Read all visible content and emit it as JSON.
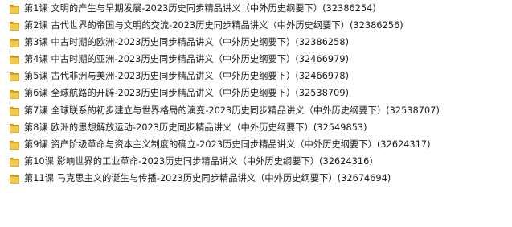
{
  "folders": [
    {
      "label": "第1课  文明的产生与早期发展-2023历史同步精品讲义（中外历史纲要下）(32386254)"
    },
    {
      "label": "第2课  古代世界的帝国与文明的交流-2023历史同步精品讲义（中外历史纲要下）(32386256)"
    },
    {
      "label": "第3课  中古时期的欧洲-2023历史同步精品讲义（中外历史纲要下）(32386258)"
    },
    {
      "label": "第4课  中古时期的亚洲-2023历史同步精品讲义（中外历史纲要下）(32466979)"
    },
    {
      "label": "第5课  古代非洲与美洲-2023历史同步精品讲义（中外历史纲要下）(32466978)"
    },
    {
      "label": "第6课  全球航路的开辟-2023历史同步精品讲义（中外历史纲要下）(32538709)"
    },
    {
      "label": "第7课  全球联系的初步建立与世界格局的演变-2023历史同步精品讲义（中外历史纲要下）(32538707)"
    },
    {
      "label": "第8课  欧洲的思想解放运动-2023历史同步精品讲义（中外历史纲要下）(32549853)"
    },
    {
      "label": "第9课  资产阶级革命与资本主义制度的确立-2023历史同步精品讲义（中外历史纲要下）(32624317)"
    },
    {
      "label": "第10课  影响世界的工业革命-2023历史同步精品讲义（中外历史纲要下）(32624316)"
    },
    {
      "label": "第11课  马克思主义的诞生与传播-2023历史同步精品讲义（中外历史纲要下）(32674694)"
    }
  ],
  "icon": "folder-icon",
  "colors": {
    "folder_back": "#d9a520",
    "folder_front": "#f3c94a",
    "folder_edge": "#b7861a",
    "text": "#1a1a1a"
  }
}
